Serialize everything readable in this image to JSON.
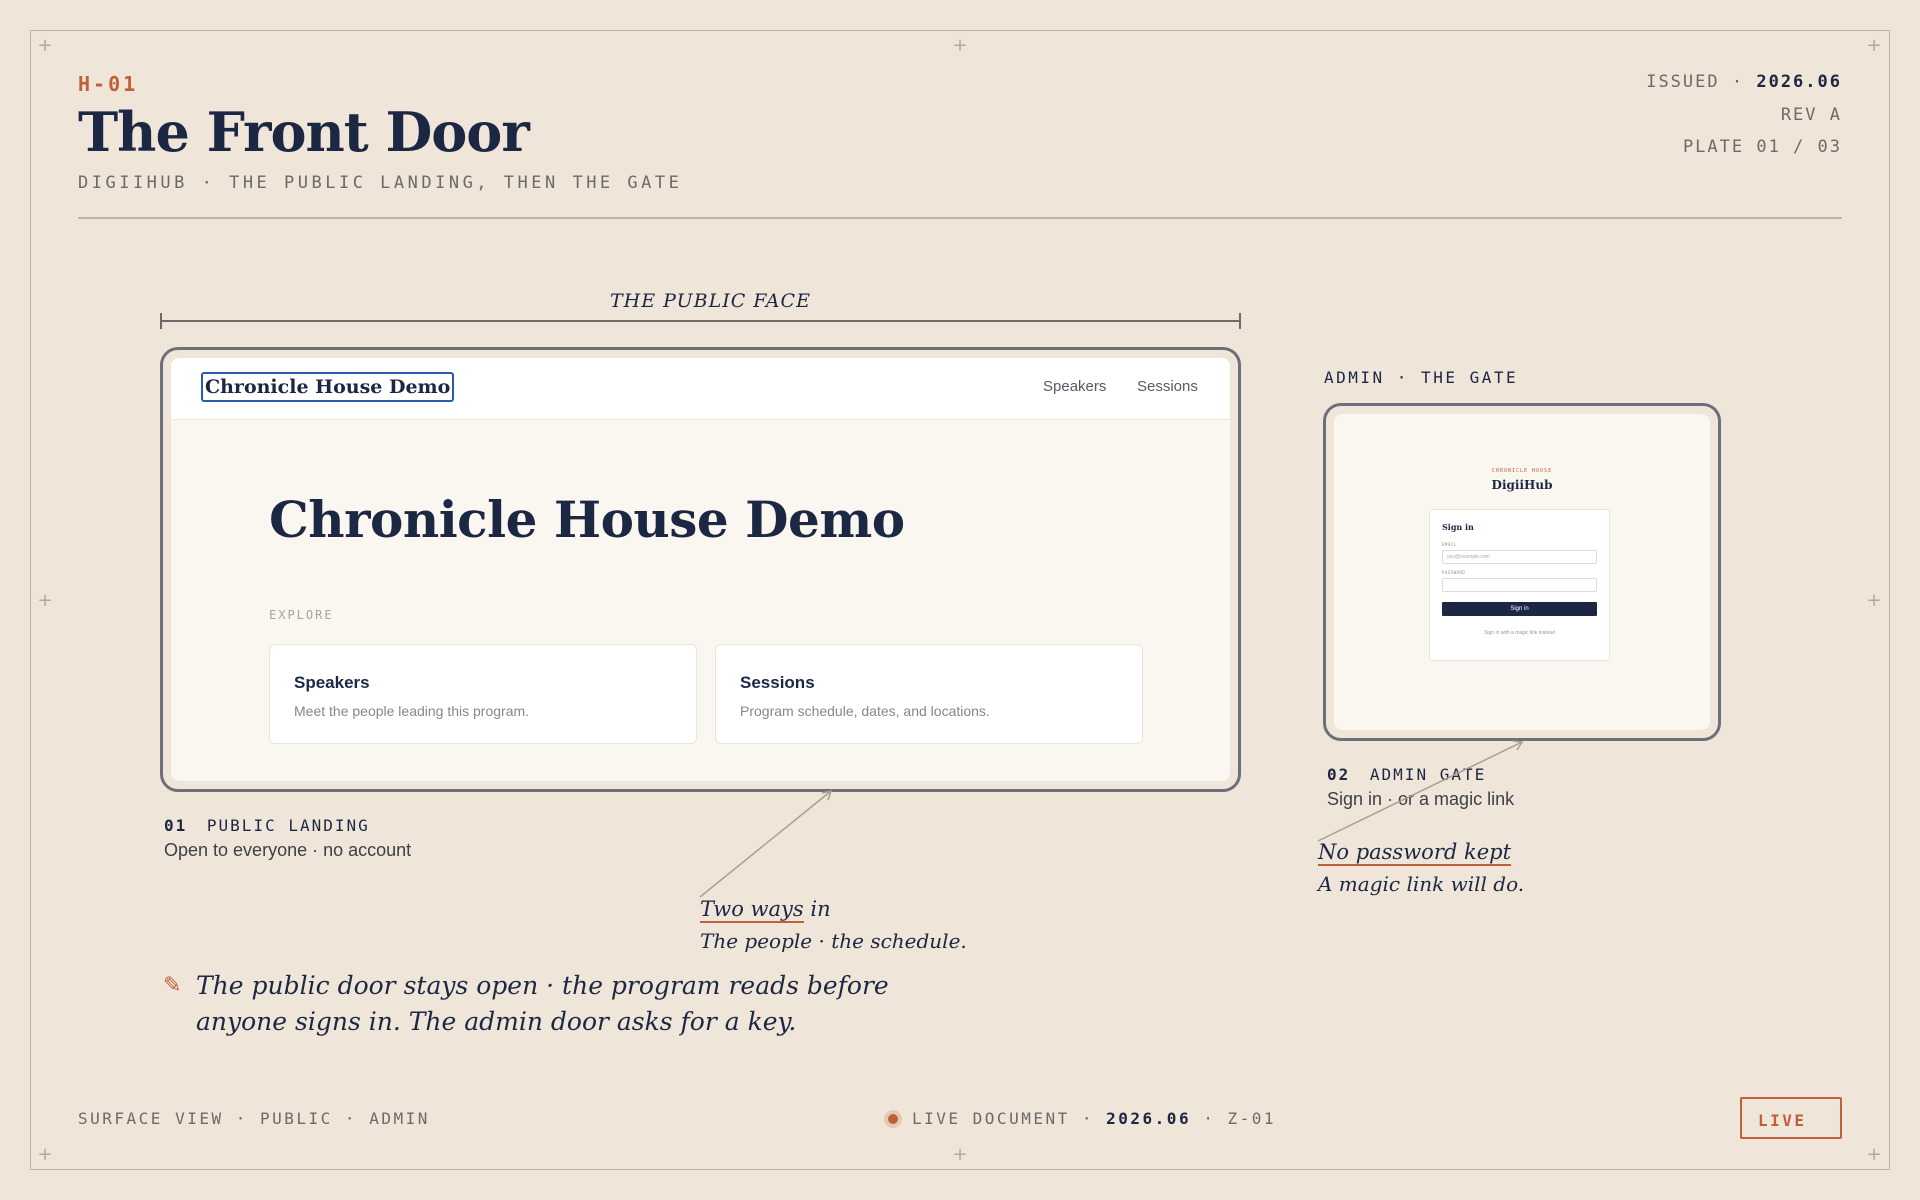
{
  "header": {
    "code": "H-01",
    "title": "The Front Door",
    "subtitle": "DIGIIHUB · THE PUBLIC LANDING, THEN THE GATE",
    "issued_label": "ISSUED ·",
    "issued_value": "2026.06",
    "rev": "REV A",
    "plate": "PLATE 01 / 03"
  },
  "public_face": {
    "dimension_label": "THE PUBLIC FACE",
    "site": {
      "brand": "Chronicle House Demo",
      "nav": [
        "Speakers",
        "Sessions"
      ],
      "hero_title": "Chronicle House Demo",
      "explore_label": "EXPLORE",
      "cards": [
        {
          "title": "Speakers",
          "desc": "Meet the people leading this program."
        },
        {
          "title": "Sessions",
          "desc": "Program schedule, dates, and locations."
        }
      ]
    },
    "caption": {
      "num": "01",
      "label": "PUBLIC LANDING",
      "sub": "Open to everyone · no account"
    }
  },
  "admin": {
    "section_label": "ADMIN · THE GATE",
    "eyebrow": "CHRONICLE HOUSE",
    "brand": "DigiiHub",
    "login": {
      "heading": "Sign in",
      "email_label": "EMAIL",
      "email_placeholder": "you@example.com",
      "password_label": "PASSWORD",
      "button": "Sign in",
      "magic_link": "Sign in with a magic link instead"
    },
    "caption": {
      "num": "02",
      "label": "ADMIN GATE",
      "sub": "Sign in · or a magic link"
    }
  },
  "notes": {
    "two_ways_underlined": "Two ways",
    "two_ways_rest": " in",
    "two_ways_sub": "The people · the schedule.",
    "no_password_underlined": "No password kept",
    "no_password_sub": "A magic link will do.",
    "pencil_icon": "pencil-icon",
    "paragraph_line1": "The public door stays open · the program reads before",
    "paragraph_line2": "anyone signs in. The admin door asks for a key."
  },
  "footer": {
    "left": "SURFACE VIEW · PUBLIC · ADMIN",
    "mid_label": "LIVE DOCUMENT ·",
    "mid_date": "2026.06",
    "mid_zone": "· Z-01",
    "badge": "LIVE"
  },
  "colors": {
    "background": "#efe5d8",
    "ink": "#1c2744",
    "accent": "#c0603a",
    "focus": "#2a5cae"
  }
}
